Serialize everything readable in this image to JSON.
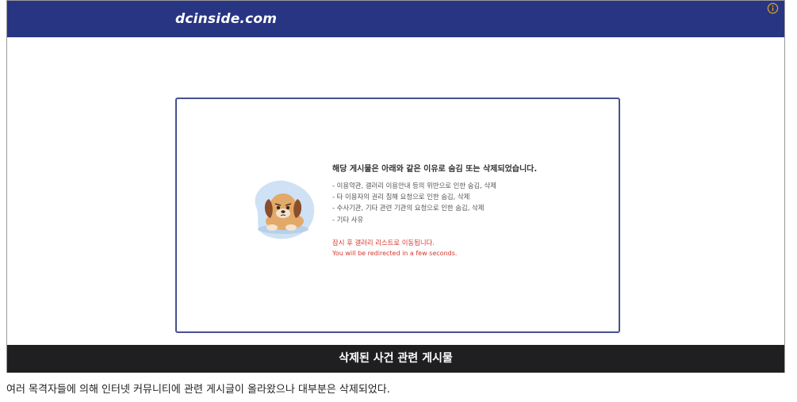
{
  "header": {
    "logo": "dcinside.com",
    "info_icon": "info-circle-icon"
  },
  "notice": {
    "title": "해당 게시물은 아래와 같은 이유로 숨김 또는 삭제되었습니다.",
    "reasons": [
      "- 이용약관, 갤러리 이용안내 등의 위반으로 인한 숨김, 삭제",
      "- 타 이용자의 권리 침해 요청으로 인한 숨김, 삭제",
      "- 수사기관, 기타 관련 기관의 요청으로 인한 숨김, 삭제",
      "- 기타 사유"
    ],
    "redirect_ko": "잠시 후 갤러리 리스트로 이동됩니다.",
    "redirect_en": "You will be redirected in a few seconds.",
    "illustration": "sad-puppy-illustration",
    "colors": {
      "alert_red": "#d7372c",
      "brand_blue": "#283583"
    }
  },
  "caption": "삭제된 사건 관련 게시물",
  "article": {
    "text": "여러 목격자들에 의해 인터넷 커뮤니티에 관련 게시글이 올라왔으나 대부분은 삭제되었다."
  }
}
